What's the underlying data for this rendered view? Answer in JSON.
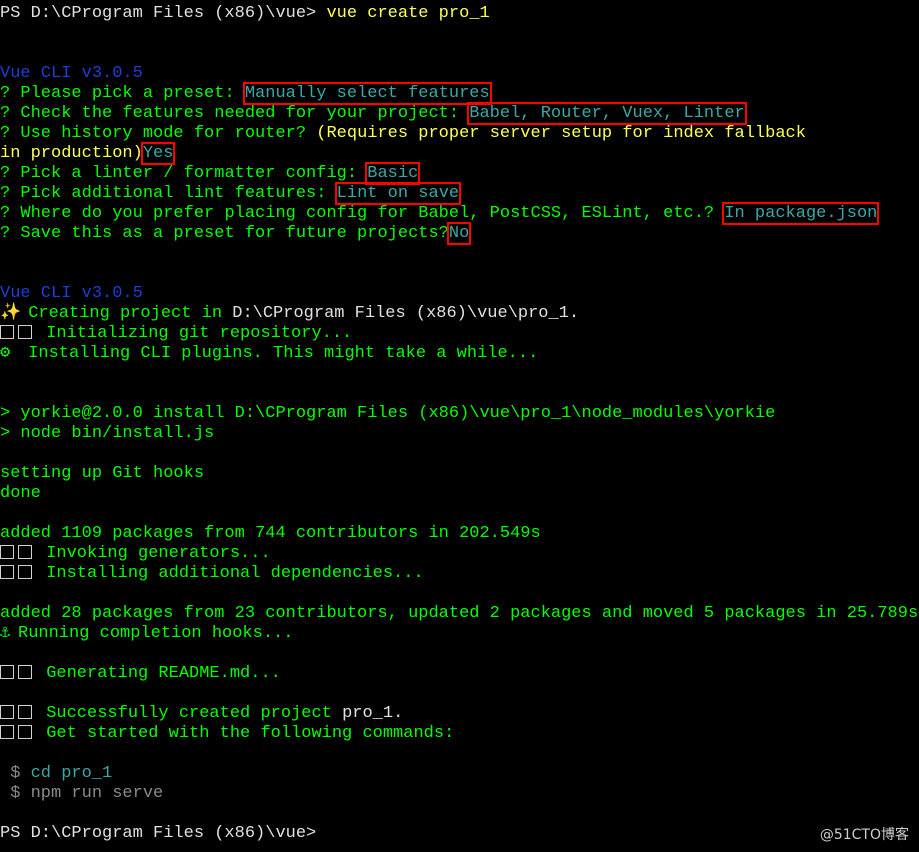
{
  "lines": {
    "l01_ps": "PS D:\\CProgram Files (x86)\\vue>",
    "l01_cmd": "vue create pro_1",
    "l04_ver": "Vue CLI v3.0.5",
    "l05_q": "? ",
    "l05_label": "Please pick a preset:",
    "l05_ans": "Manually select features",
    "l06_q": "? ",
    "l06_label": "Check the features needed for your project:",
    "l06_ans": "Babel, Router, Vuex, Linter",
    "l07_q": "? ",
    "l07_label": "Use history mode for router?",
    "l07_note": "(Requires proper server setup for index fallback",
    "l08_note": "in production)",
    "l08_ans": "Yes",
    "l09_q": "? ",
    "l09_label": "Pick a linter / formatter config:",
    "l09_ans": "Basic",
    "l10_q": "? ",
    "l10_label": "Pick additional lint features:",
    "l10_ans": "Lint on save",
    "l11_q": "? ",
    "l11_label": "Where do you prefer placing config for Babel, PostCSS, ESLint, etc.?",
    "l11_ans": "In package.json",
    "l12_q": "? ",
    "l12_label": "Save this as a preset for future projects?",
    "l12_ans": "No",
    "l15_ver": "Vue CLI v3.0.5",
    "l16_icon": "✨",
    "l16_text": "Creating project in",
    "l16_path": "D:\\CProgram Files (x86)\\vue\\pro_1.",
    "l17_text": "Initializing git repository...",
    "l18_icon": "⚙",
    "l18_text": "Installing CLI plugins. This might take a while...",
    "l21_text": "> yorkie@2.0.0 install D:\\CProgram Files (x86)\\vue\\pro_1\\node_modules\\yorkie",
    "l22_text": "> node bin/install.js",
    "l24_text": "setting up Git hooks",
    "l25_text": "done",
    "l27_text": "added 1109 packages from 744 contributors in 202.549s",
    "l28_text": "Invoking generators...",
    "l29_text": "Installing additional dependencies...",
    "l31_text": "added 28 packages from 23 contributors, updated 2 packages and moved 5 packages in 25.789s",
    "l32_icon": "⚓",
    "l32_text": "Running completion hooks...",
    "l34_text": "Generating README.md...",
    "l36_text": "Successfully created project",
    "l36_name": "pro_1.",
    "l37_text": "Get started with the following commands:",
    "l39_prompt": " $",
    "l39_cmd": "cd pro_1",
    "l40_prompt": " $",
    "l40_cmd": "npm run serve",
    "l42_ps": "PS D:\\CProgram Files (x86)\\vue>"
  },
  "watermark": "@51CTO博客",
  "colors": {
    "background": "#000000",
    "text_green": "#00ff00",
    "text_white": "#e0e0e0",
    "text_yellow": "#ffff55",
    "version_blue": "#1f3dd8",
    "answer_cyan": "#3aa8a8",
    "highlight_red": "#ff0000"
  }
}
